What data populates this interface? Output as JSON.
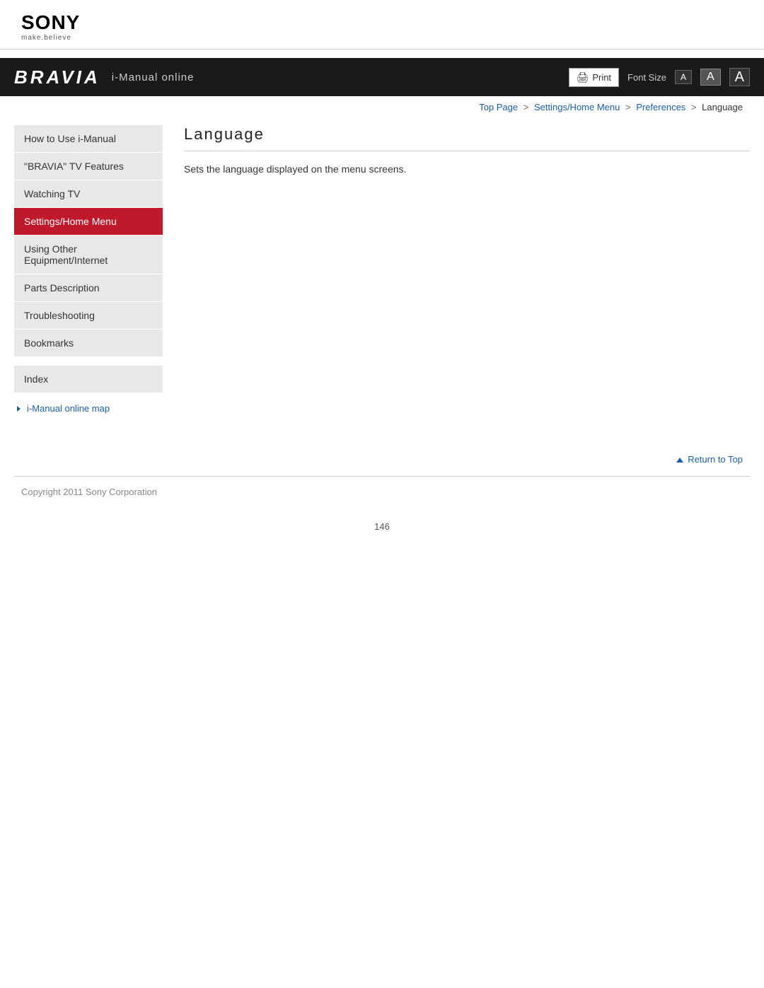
{
  "logo": {
    "brand": "SONY",
    "tagline": "make.believe"
  },
  "header": {
    "bravia_logo": "BRAVIA",
    "subtitle": "i-Manual online",
    "print_label": "Print",
    "font_size_label": "Font Size",
    "font_small": "A",
    "font_medium": "A",
    "font_large": "A"
  },
  "breadcrumb": {
    "top_page": "Top Page",
    "settings_home": "Settings/Home Menu",
    "preferences": "Preferences",
    "current": "Language",
    "sep": ">"
  },
  "sidebar": {
    "items": [
      {
        "id": "how-to-use",
        "label": "How to Use i-Manual",
        "active": false
      },
      {
        "id": "bravia-tv",
        "label": "\"BRAVIA\" TV Features",
        "active": false
      },
      {
        "id": "watching-tv",
        "label": "Watching TV",
        "active": false
      },
      {
        "id": "settings-home",
        "label": "Settings/Home Menu",
        "active": true
      },
      {
        "id": "using-other",
        "label": "Using Other Equipment/Internet",
        "active": false
      },
      {
        "id": "parts-desc",
        "label": "Parts Description",
        "active": false
      },
      {
        "id": "troubleshooting",
        "label": "Troubleshooting",
        "active": false
      },
      {
        "id": "bookmarks",
        "label": "Bookmarks",
        "active": false
      }
    ],
    "index_item": {
      "id": "index",
      "label": "Index"
    },
    "online_map_link": "i-Manual online map"
  },
  "content": {
    "page_title": "Language",
    "description": "Sets the language displayed on the menu screens."
  },
  "return_top": {
    "label": "Return to Top"
  },
  "footer": {
    "copyright": "Copyright 2011 Sony Corporation"
  },
  "page_number": "146"
}
